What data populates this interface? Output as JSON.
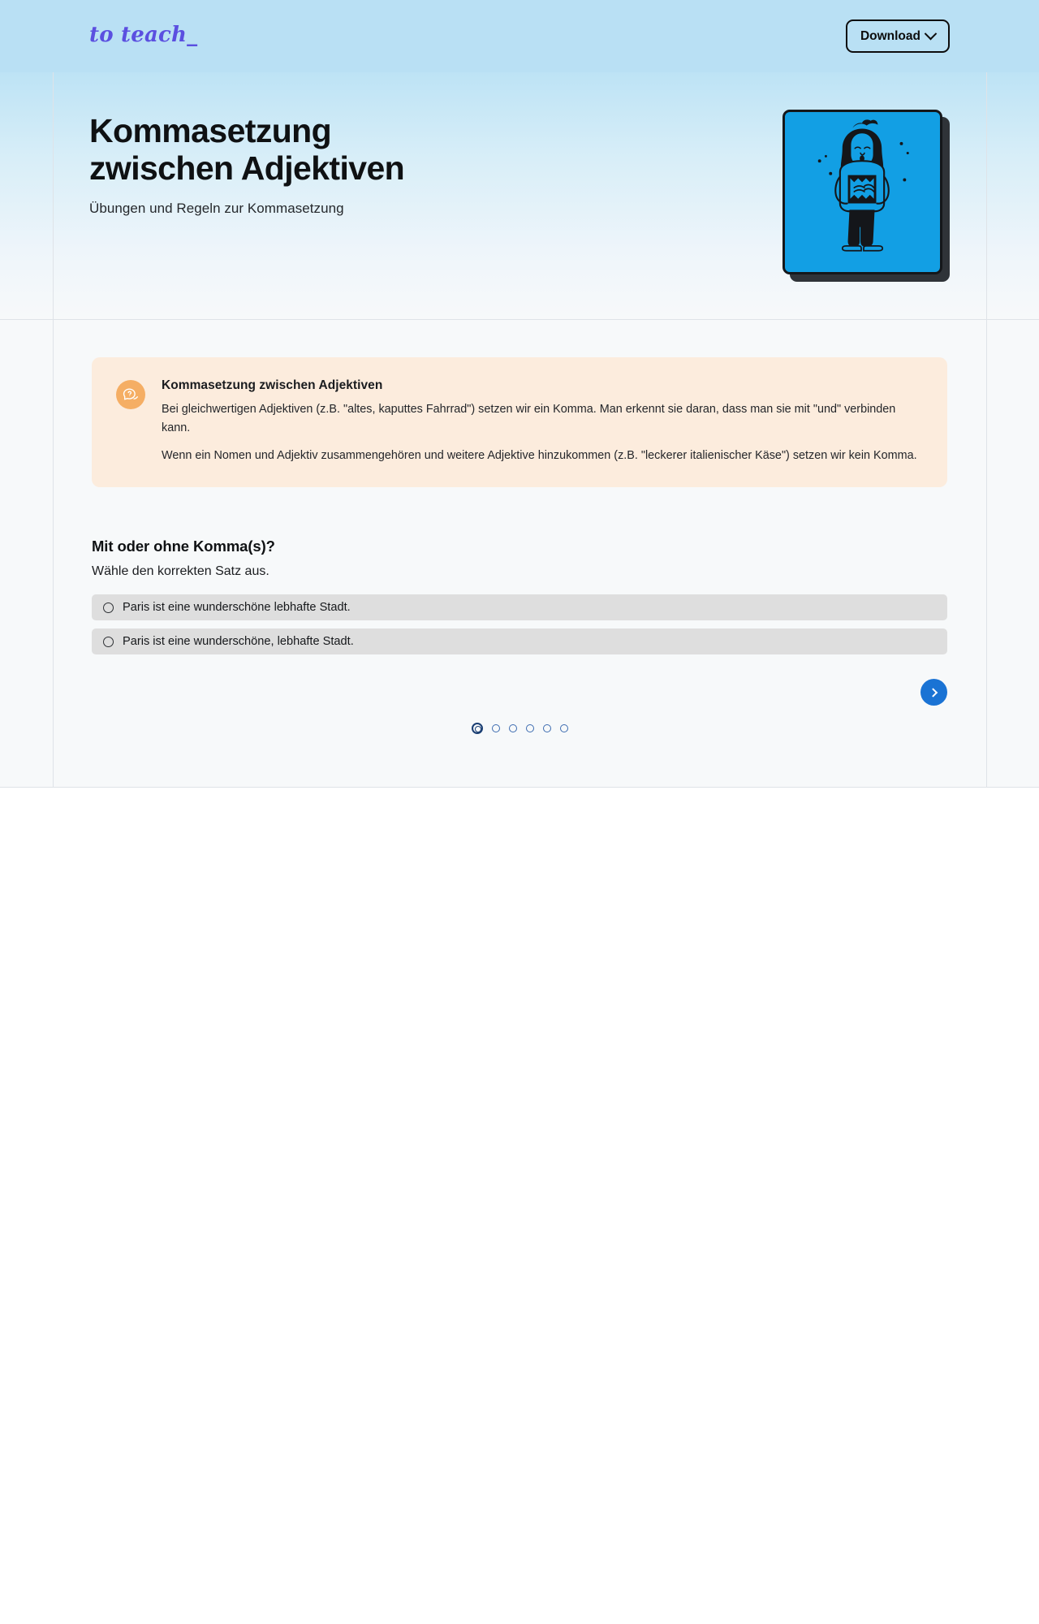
{
  "header": {
    "brand": "to teach_",
    "download_label": "Download",
    "download_chevron_icon": "chevron-down-icon"
  },
  "hero": {
    "title": "Kommasetzung\nzwischen Adjektiven",
    "subtitle": "Übungen und Regeln zur Kommasetzung",
    "illustration_name": "student-holding-book-illustration",
    "illustration_bg": "#129fe4"
  },
  "info_box": {
    "icon": "question-speech-bubble-icon",
    "icon_bg": "#f5ae64",
    "background": "#fcecdd",
    "title": "Kommasetzung zwischen Adjektiven",
    "paragraphs": [
      "Bei gleichwertigen Adjektiven (z.B. \"altes, kaputtes Fahrrad\") setzen wir ein Komma. Man erkennt sie daran, dass man sie mit \"und\" verbinden kann.",
      "Wenn ein Nomen und Adjektiv zusammengehören und weitere Adjektive hinzukommen (z.B. \"leckerer italienischer Käse\") setzen wir kein Komma."
    ]
  },
  "exercise": {
    "title": "Mit oder ohne Komma(s)?",
    "instruction": "Wähle den korrekten Satz aus.",
    "options": [
      {
        "label": "Paris ist eine wunderschöne lebhafte Stadt.",
        "selected": false
      },
      {
        "label": "Paris ist eine wunderschöne, lebhafte Stadt.",
        "selected": false
      }
    ],
    "next_icon": "chevron-right-icon",
    "next_color": "#1a73d4"
  },
  "pagination": {
    "total": 6,
    "current": 1,
    "active_color": "#1b3f73",
    "inactive_color": "#3c6bb0"
  }
}
